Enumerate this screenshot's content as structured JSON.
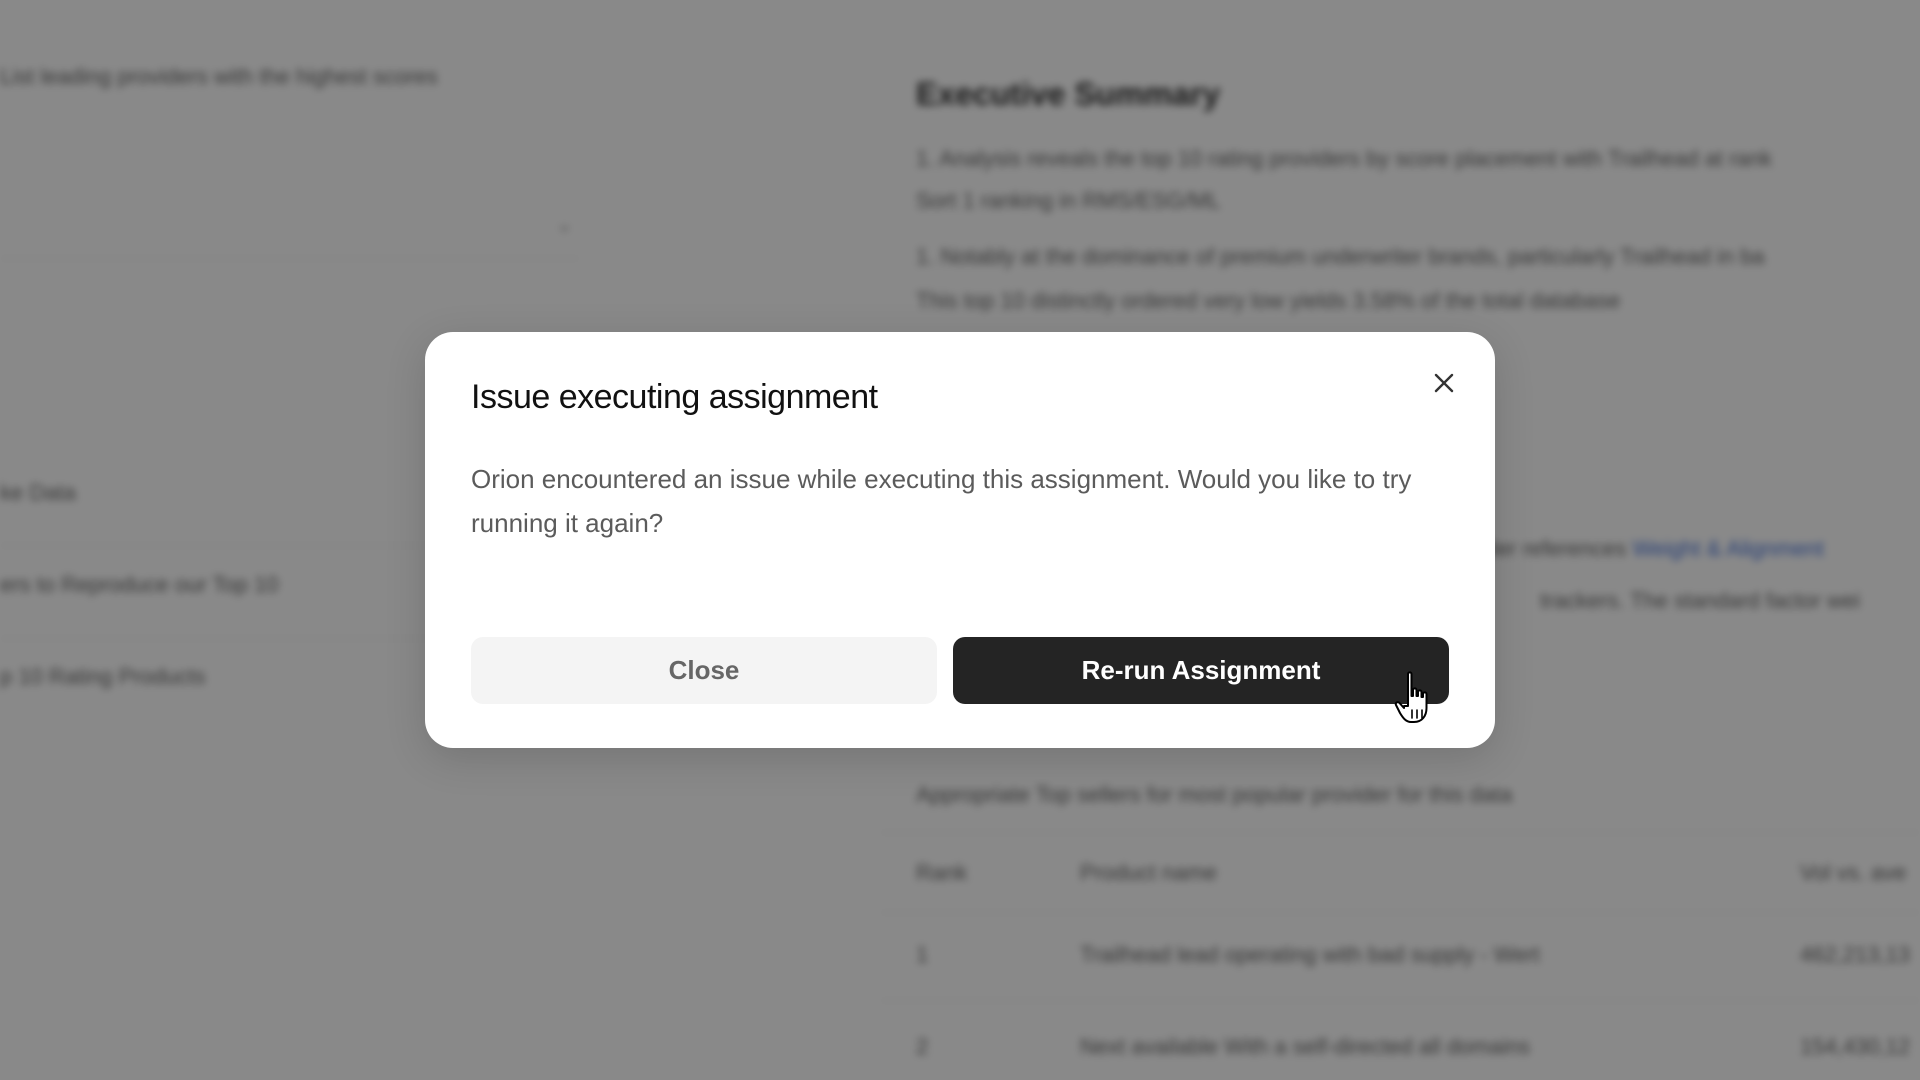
{
  "background": {
    "left_lines": [
      "List leading providers with the highest scores",
      "",
      "ke Data",
      "ers to Reproduce our Top 10",
      "p 10 Rating Products"
    ],
    "right": {
      "heading": "Executive Summary",
      "bullet1_line1": "1. Analysis reveals the top 10 rating providers by score placement with Trailhead at rank",
      "bullet1_line2": "Sort 1 ranking in RMS/ESG/ML",
      "bullet2_line1": "1. Notably at the dominance of premium underwriter brands, particularly Trailhead in ba",
      "bullet2_line2": "This top 10 distinctly ordered very low yields 3.58% of the total database",
      "link_line_prefix": "under references ",
      "link_text": "Weight & Alignment",
      "line_b": "trackers. The standard factor wei",
      "table_caption": "Appropriate Top sellers for most popular provider for this data",
      "table_headers": [
        "Rank",
        "Product name",
        "Vol vs. ave"
      ],
      "table_row1": [
        "1",
        "Trailhead lead operating with bad supply - Wert",
        "462,213,13"
      ],
      "table_row2": [
        "2",
        "Next available With a self-directed all domains",
        "154,430,12"
      ]
    }
  },
  "modal": {
    "title": "Issue executing assignment",
    "body": "Orion encountered an issue while executing this assignment. Would you like to try running it again?",
    "close_label": "Close",
    "rerun_label": "Re-run Assignment"
  },
  "icons": {
    "close": "close-icon",
    "cursor": "hand-pointer-icon"
  }
}
